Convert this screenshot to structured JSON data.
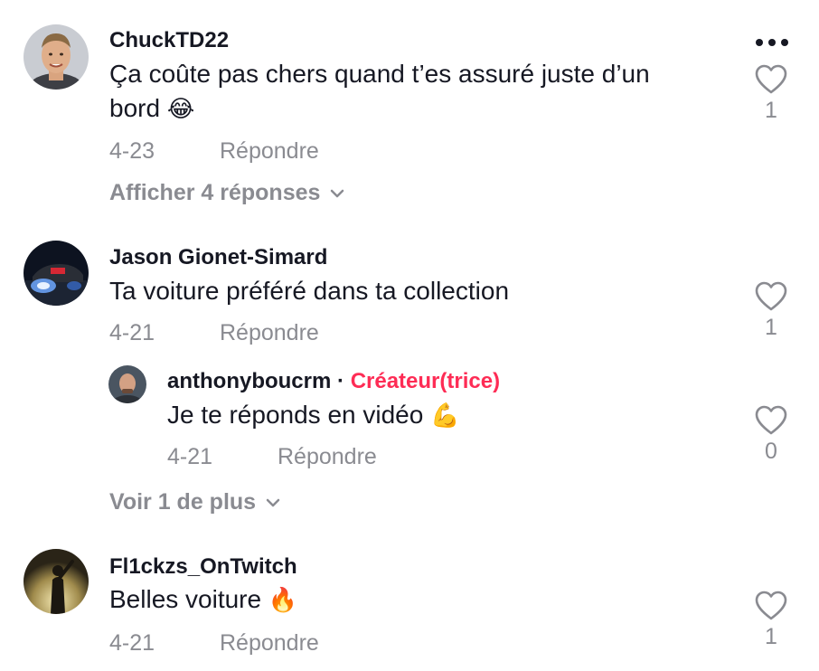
{
  "comments": [
    {
      "username": "ChuckTD22",
      "text": "Ça coûte pas chers quand t’es assuré juste d’un bord",
      "emoji": "😂",
      "date": "4-23",
      "reply_label": "Répondre",
      "likes": "1",
      "expand_label": "Afficher 4 réponses",
      "avatar_icon": "man-portrait-avatar"
    },
    {
      "username": "Jason Gionet-Simard",
      "text": "Ta voiture préféré dans ta collection",
      "date": "4-21",
      "reply_label": "Répondre",
      "likes": "1",
      "avatar_icon": "car-night-avatar",
      "replies": [
        {
          "username": "anthonyboucrm",
          "separator": "·",
          "creator_label": "Créateur(trice)",
          "text": "Je te réponds en vidéo",
          "emoji": "💪",
          "date": "4-21",
          "reply_label": "Répondre",
          "likes": "0",
          "avatar_icon": "bald-man-avatar"
        }
      ],
      "expand_label": "Voir 1 de plus"
    },
    {
      "username": "Fl1ckzs_OnTwitch",
      "text": "Belles voiture",
      "emoji": "🔥",
      "date": "4-21",
      "reply_label": "Répondre",
      "likes": "1",
      "avatar_icon": "concert-silhouette-avatar"
    }
  ],
  "colors": {
    "text": "#161823",
    "muted": "#8a8b91",
    "creator": "#fe2c55"
  },
  "icons": {
    "more": "more-dots-icon",
    "like": "heart-outline-icon",
    "chevron": "chevron-down-icon"
  }
}
